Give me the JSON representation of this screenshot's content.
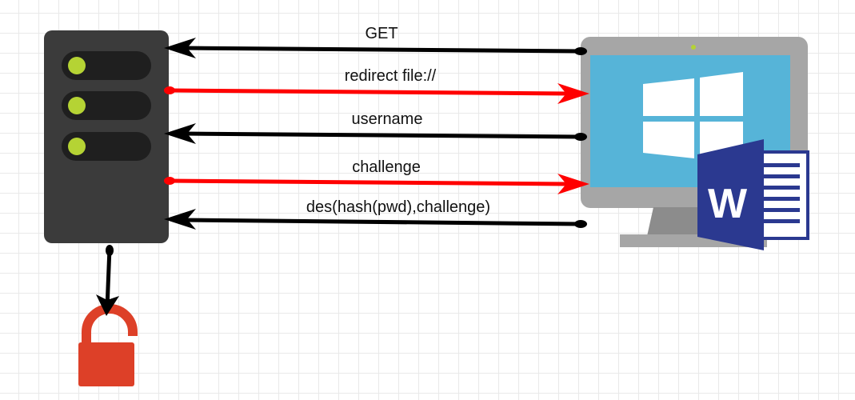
{
  "diagram": {
    "messages": [
      {
        "label": "GET",
        "direction": "to-server",
        "color": "#000000"
      },
      {
        "label": "redirect file://",
        "direction": "to-client",
        "color": "#ff0000"
      },
      {
        "label": "username",
        "direction": "to-server",
        "color": "#000000"
      },
      {
        "label": "challenge",
        "direction": "to-client",
        "color": "#ff0000"
      },
      {
        "label": "des(hash(pwd),challenge)",
        "direction": "to-server",
        "color": "#000000"
      }
    ],
    "server": {
      "icon": "server-icon",
      "body_color": "#3b3b3b",
      "led_color": "#b5d334"
    },
    "client": {
      "icon": "windows-monitor-icon",
      "screen_color": "#56b4d8",
      "frame_color": "#a6a6a6"
    },
    "document": {
      "icon": "word-document-icon",
      "letter": "W",
      "color": "#2b3990"
    },
    "lock": {
      "icon": "open-padlock-icon",
      "color": "#dd4028"
    }
  }
}
